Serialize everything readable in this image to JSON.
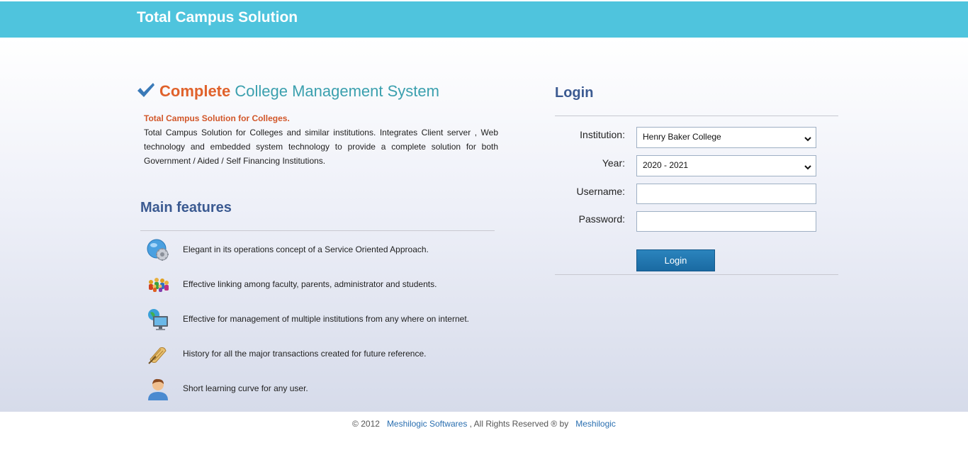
{
  "header": {
    "title": "Total Campus Solution"
  },
  "hero": {
    "headline_strong": "Complete",
    "headline_rest": "College Management System",
    "intro_title": "Total Campus Solution for Colleges.",
    "intro_body": "Total Campus Solution for Colleges and similar institutions. Integrates Client server , Web technology and embedded system technology to provide a complete solution for both Government / Aided / Self Financing Institutions."
  },
  "features": {
    "title": "Main features",
    "items": [
      {
        "icon": "gear-globe-icon",
        "text": "Elegant in its operations concept of a Service Oriented Approach."
      },
      {
        "icon": "people-group-icon",
        "text": "Effective linking among faculty, parents, administrator and students."
      },
      {
        "icon": "globe-monitor-icon",
        "text": "Effective for management of multiple institutions from any where on internet."
      },
      {
        "icon": "scroll-quill-icon",
        "text": "History for all the major transactions created for future reference."
      },
      {
        "icon": "user-avatar-icon",
        "text": "Short learning curve for any user."
      }
    ]
  },
  "login": {
    "title": "Login",
    "institution_label": "Institution:",
    "institution_value": "Henry Baker College",
    "year_label": "Year:",
    "year_value": "2020 - 2021",
    "username_label": "Username:",
    "username_value": "",
    "password_label": "Password:",
    "password_value": "",
    "button_label": "Login"
  },
  "footer": {
    "copyright": "© 2012 ",
    "company_link": "Meshilogic Softwares",
    "rights": " , All Rights Reserved ® by ",
    "brand_link": "Meshilogic"
  },
  "colors": {
    "topbar": "#4fc4dd",
    "accent_orange": "#e0622b",
    "accent_teal": "#3ba0ae",
    "heading_blue": "#3b5a91",
    "button_blue": "#1a6aa2"
  }
}
